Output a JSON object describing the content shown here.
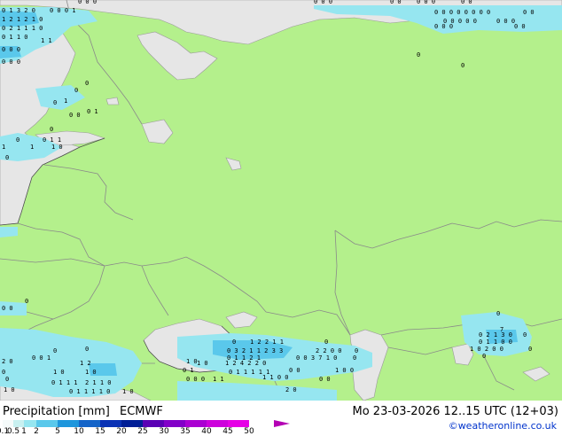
{
  "footer": {
    "title": "Precipitation [mm]",
    "model": "ECMWF",
    "datetime": "Mo 23-03-2026 12..15 UTC (12+03)",
    "credit": "©weatheronline.co.uk"
  },
  "legend": {
    "ticks": [
      "0.1",
      "0.5",
      "1",
      "2",
      "5",
      "10",
      "15",
      "20",
      "25",
      "30",
      "35",
      "40",
      "45",
      "50"
    ],
    "colors": [
      "#f5fafa",
      "#c8f0f0",
      "#96e6f0",
      "#5ac8eb",
      "#1e96dc",
      "#1464c8",
      "#0a32b4",
      "#001e96",
      "#5a00b4",
      "#8200c8",
      "#aa00d2",
      "#cd00dc",
      "#e600e6",
      "#b400b4"
    ]
  },
  "map": {
    "land_color": "#b4f08c",
    "sea_color": "#e6e6e6",
    "border_color": "#8a8a8a",
    "precip_color": "#96e6f0",
    "precip_heavy_color": "#5ac8eb"
  }
}
